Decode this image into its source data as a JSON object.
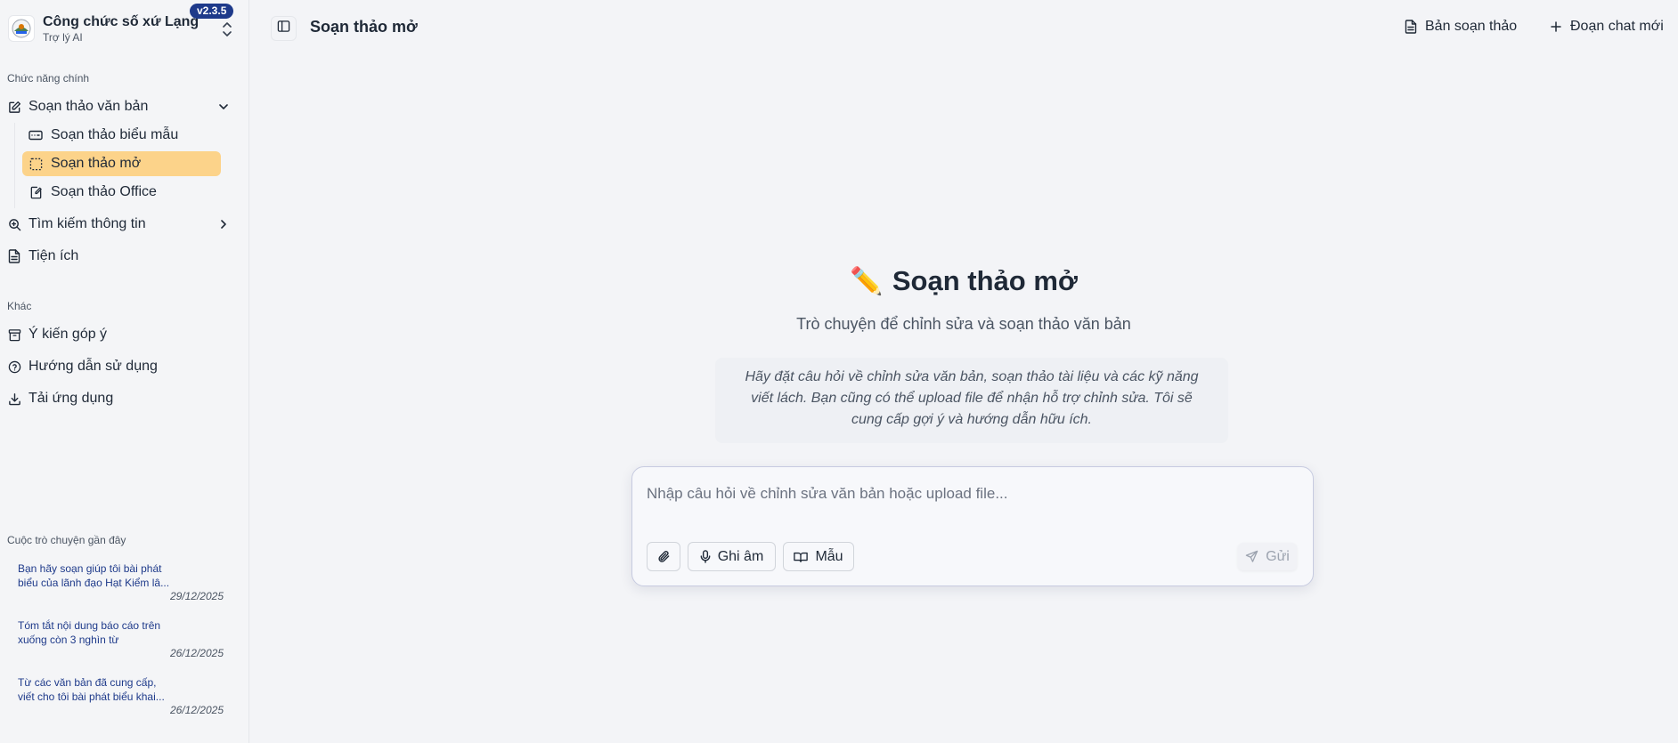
{
  "app": {
    "name": "Công chức số xứ Lạng",
    "subtitle": "Trợ lý AI",
    "version": "v2.3.5"
  },
  "sidebar": {
    "main_section_label": "Chức năng chính",
    "items": [
      {
        "label": "Soạn thảo văn bản",
        "icon": "edit-icon",
        "expanded": true
      },
      {
        "label": "Tìm kiếm thông tin",
        "icon": "search-doc-icon",
        "expanded": false
      },
      {
        "label": "Tiện ích",
        "icon": "document-icon"
      }
    ],
    "sub_items": [
      {
        "label": "Soạn thảo biểu mẫu",
        "icon": "form-icon"
      },
      {
        "label": "Soạn thảo mở",
        "icon": "dashed-square-icon",
        "active": true
      },
      {
        "label": "Soạn thảo Office",
        "icon": "file-edit-icon"
      }
    ],
    "other_section_label": "Khác",
    "other_items": [
      {
        "label": "Ý kiến góp ý",
        "icon": "archive-icon"
      },
      {
        "label": "Hướng dẫn sử dụng",
        "icon": "help-circle-icon"
      },
      {
        "label": "Tải ứng dụng",
        "icon": "download-icon"
      }
    ],
    "recent_label": "Cuộc trò chuyện gần đây",
    "recent": [
      {
        "line1": "Bạn hãy soạn giúp tôi bài phát",
        "line2": "biểu của lãnh đạo Hạt Kiểm lâ...",
        "date": "29/12/2025"
      },
      {
        "line1": "Tóm tắt nội dung báo cáo trên",
        "line2": "xuống còn 3 nghìn từ",
        "date": "26/12/2025"
      },
      {
        "line1": "Từ các văn bản đã cung cấp,",
        "line2": "viết cho tôi bài phát biểu khai...",
        "date": "26/12/2025"
      }
    ]
  },
  "header": {
    "title": "Soạn thảo mở",
    "drafts_label": "Bản soạn thảo",
    "new_chat_label": "Đoạn chat mới"
  },
  "main": {
    "emoji": "✏️",
    "title": "Soạn thảo mở",
    "subtitle": "Trò chuyện để chỉnh sửa và soạn thảo văn bản",
    "hint_line1": "Hãy đặt câu hỏi về chỉnh sửa văn bản, soạn thảo tài liệu và các kỹ năng",
    "hint_line2": "viết lách. Bạn cũng có thể upload file để nhận hỗ trợ chỉnh sửa. Tôi sẽ",
    "hint_line3": "cung cấp gợi ý và hướng dẫn hữu ích."
  },
  "composer": {
    "placeholder": "Nhập câu hỏi về chỉnh sửa văn bản hoặc upload file...",
    "value": "",
    "record_label": "Ghi âm",
    "template_label": "Mẫu",
    "send_label": "Gửi"
  },
  "colors": {
    "active_item": "#fcd38a",
    "badge": "#1e3a8a",
    "recent_text": "#1e3a8a",
    "background": "#f3f4f7"
  }
}
